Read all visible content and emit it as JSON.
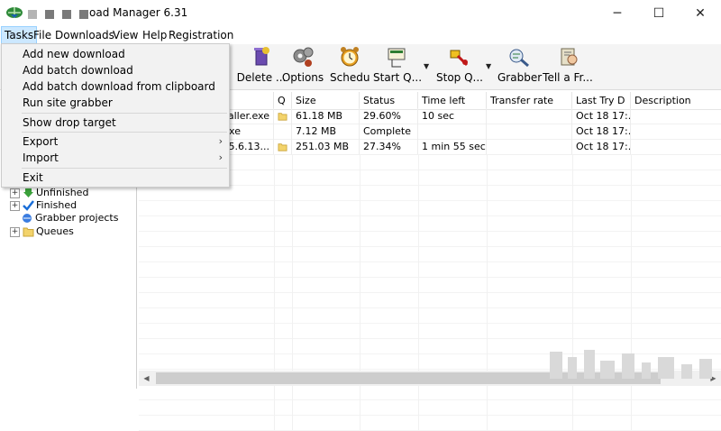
{
  "window": {
    "title": "oad Manager 6.31",
    "controls": {
      "minimize": "─",
      "maximize": "☐",
      "close": "✕"
    }
  },
  "menubar": {
    "items": [
      "Tasks",
      "File",
      "Downloads",
      "View",
      "Help",
      "Registration"
    ],
    "active": "Tasks"
  },
  "toolbar": {
    "buttons": [
      {
        "label": "Delete ...",
        "icon": "delete-icon"
      },
      {
        "label": "Options",
        "icon": "gears-icon"
      },
      {
        "label": "Schedu",
        "icon": "alarm-clock-icon"
      },
      {
        "label": "Start Q...",
        "icon": "start-queue-icon"
      },
      {
        "label": "Stop Q...",
        "icon": "stop-queue-icon"
      },
      {
        "label": "Grabber",
        "icon": "grabber-icon"
      },
      {
        "label": "Tell a Fr...",
        "icon": "tell-friend-icon"
      }
    ]
  },
  "tasks_menu": {
    "items": [
      {
        "label": "Add new download"
      },
      {
        "label": "Add batch download"
      },
      {
        "label": "Add batch download from clipboard"
      },
      {
        "label": "Run site grabber"
      },
      {
        "label": "Show drop target"
      },
      {
        "label": "Export",
        "submenu": true
      },
      {
        "label": "Import",
        "submenu": true
      },
      {
        "label": "Exit"
      }
    ]
  },
  "tree": {
    "items": [
      {
        "label": "Unfinished",
        "icon": "down-arrow-icon"
      },
      {
        "label": "Finished",
        "icon": "checkmark-icon"
      },
      {
        "label": "Grabber projects",
        "icon": "grabber-project-icon"
      },
      {
        "label": "Queues",
        "icon": "folder-icon"
      }
    ]
  },
  "table": {
    "columns": [
      "Q",
      "Size",
      "Status",
      "Time left",
      "Transfer rate",
      "Last Try D",
      "Description"
    ],
    "rows": [
      {
        "name": "staller.exe",
        "q": "folder-icon",
        "size": "61.18  MB",
        "status": "29.60%",
        "time_left": "10 sec",
        "rate": "",
        "last_try": "Oct 18 17:...",
        "description": ""
      },
      {
        "name": "exe",
        "q": "",
        "size": "7.12  MB",
        "status": "Complete",
        "time_left": "",
        "rate": "",
        "last_try": "Oct 18 17:...",
        "description": ""
      },
      {
        "name": "e-5.6.13...",
        "q": "folder-icon",
        "size": "251.03  MB",
        "status": "27.34%",
        "time_left": "1 min 55 sec",
        "rate": "",
        "last_try": "Oct 18 17:...",
        "description": ""
      }
    ]
  },
  "scrollbar": {
    "left_arrow": "◀",
    "right_arrow": "▶"
  }
}
